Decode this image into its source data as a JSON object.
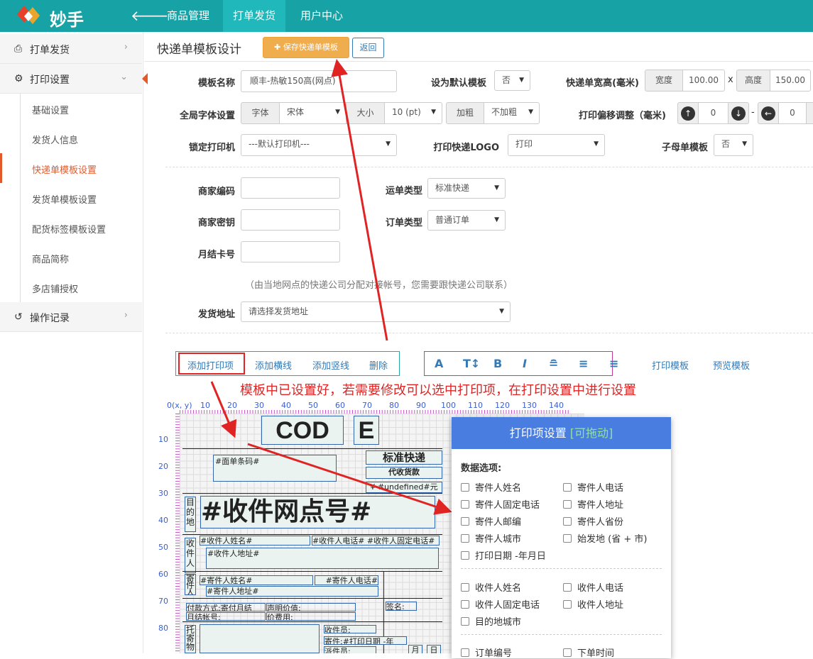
{
  "topbar": {
    "brand": "妙手",
    "nav": [
      "商品管理",
      "打单发货",
      "用户中心"
    ],
    "active_nav": "打单发货"
  },
  "sidebar": {
    "items": [
      {
        "label": "打单发货",
        "icon": "printer-icon"
      },
      {
        "label": "打印设置",
        "icon": "gear-icon"
      },
      {
        "label": "操作记录",
        "icon": "history-icon"
      }
    ],
    "subitems": [
      "基础设置",
      "发货人信息",
      "快递单模板设置",
      "发货单模板设置",
      "配货标签模板设置",
      "商品简称",
      "多店铺授权"
    ],
    "active_sub": "快递单模板设置"
  },
  "header": {
    "title": "快递单模板设计",
    "save_label": "保存快递单模板",
    "back_label": "返回"
  },
  "form": {
    "template_name_label": "模板名称",
    "template_name_value": "顺丰-热敏150高(网点)",
    "default_label": "设为默认模板",
    "default_value": "否",
    "size_label": "快递单宽高(毫米)",
    "width_label": "宽度",
    "width_value": "100.00",
    "times": "x",
    "height_label": "高度",
    "height_value": "150.00",
    "font_label": "全局字体设置",
    "font_addon": "字体",
    "font_value": "宋体",
    "size_addon": "大小",
    "size_value": "10 (pt)",
    "bold_addon": "加粗",
    "bold_value": "不加粗",
    "offset_label": "打印偏移调整（毫米)",
    "offset_v_value": "0",
    "offset_dash": "-",
    "offset_h_value": "0",
    "printer_label": "锁定打印机",
    "printer_value": "---默认打印机---",
    "logo_label": "打印快递LOGO",
    "logo_value": "打印",
    "submaster_label": "子母单模板",
    "submaster_value": "否",
    "merchant_code_label": "商家编码",
    "merchant_key_label": "商家密钥",
    "monthly_card_label": "月结卡号",
    "waybill_type_label": "运单类型",
    "waybill_type_value": "标准快递",
    "order_type_label": "订单类型",
    "order_type_value": "普通订单",
    "hint": "（由当地网点的快递公司分配对接帐号，您需要跟快递公司联系）",
    "address_label": "发货地址",
    "address_value": "请选择发货地址"
  },
  "toolbar": {
    "add_item": "添加打印项",
    "add_hline": "添加横线",
    "add_vline": "添加竖线",
    "delete": "删除",
    "format_icons": [
      "A",
      "T↕",
      "B",
      "I",
      "≘",
      "≡",
      "≡"
    ],
    "print_template": "打印模板",
    "preview_template": "预览模板"
  },
  "annotation": "模板中已设置好，若需要修改可以选中打印项，在打印设置中进行设置",
  "designer": {
    "ruler_origin": "0(x, y)",
    "ruler_x": [
      "10",
      "20",
      "30",
      "40",
      "50",
      "60",
      "70",
      "80",
      "90",
      "100",
      "110",
      "120",
      "130",
      "140"
    ],
    "ruler_y": [
      "10",
      "20",
      "30",
      "40",
      "50",
      "60",
      "70",
      "80"
    ],
    "items": {
      "cod": "COD",
      "e": "E",
      "barcode": "#面单条码#",
      "express": "标准快递",
      "cod_fee": "代收货款",
      "cod_amount": "¥ #undefined#元",
      "dest_tag": "目的地",
      "dest_point": "#收件网点号#",
      "recv_tag": "收件人",
      "recv_name": "#收件人姓名#",
      "recv_phone": "#收件人电话# #收件人固定电话#",
      "recv_addr": "#收件人地址#",
      "send_tag": "寄件人",
      "send_name": "#寄件人姓名#",
      "send_phone": "#寄件人电话#",
      "send_addr": "#寄件人地址#",
      "pay_method": "付款方式:寄付月结",
      "declared": "声明价值:",
      "account": "月结帐号:",
      "price_fee": "价费用:",
      "sign": "签名:",
      "consign_tag": "托寄物",
      "collector": "收件员:",
      "send_date": "寄件:#打印日期 -年",
      "dispatcher": "派件员:",
      "month": "月",
      "day": "日"
    }
  },
  "panel": {
    "title": "打印项设置",
    "drag_hint": "[可拖动]",
    "subtitle": "数据选项:",
    "group1": [
      "寄件人姓名",
      "寄件人电话",
      "寄件人固定电话",
      "寄件人地址",
      "寄件人邮编",
      "寄件人省份",
      "寄件人城市",
      "始发地 (省 + 市)",
      "打印日期 -年月日"
    ],
    "group2": [
      "收件人姓名",
      "收件人电话",
      "收件人固定电话",
      "收件人地址",
      "目的地城市"
    ],
    "group3": [
      "订单编号",
      "下单时间"
    ]
  },
  "colors": {
    "topbar": "#17a2a5",
    "active_nav": "#20b8bb",
    "accent": "#e4592a",
    "save": "#f0ad4e",
    "annotation": "#e02424",
    "panel_head": "#4a7de0"
  }
}
